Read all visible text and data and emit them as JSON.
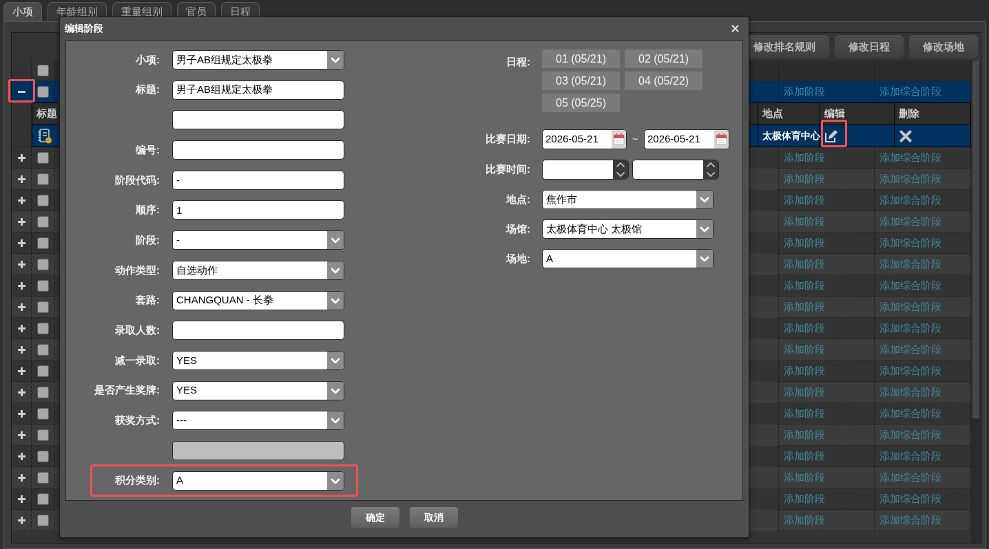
{
  "tabs": [
    {
      "label": "小项",
      "selected": true
    },
    {
      "label": "年龄组别",
      "selected": false
    },
    {
      "label": "重量组别",
      "selected": false
    },
    {
      "label": "官员",
      "selected": false
    },
    {
      "label": "日程",
      "selected": false
    }
  ],
  "toolbar": {
    "buttons": [
      "修改排名规则",
      "修改日程",
      "修改场地"
    ]
  },
  "table": {
    "header": {
      "checked": false
    },
    "rows": [
      {
        "expanded": true,
        "checked": false,
        "selected": true,
        "highlighted": true,
        "column_4": "添加阶段",
        "column_5": "添加综合阶段",
        "stages": {
          "columns": [
            "标题",
            "地点",
            "编辑",
            "删除"
          ],
          "rows": [
            {
              "selected": true,
              "location": "太极体育中心",
              "edit_highlighted": true
            }
          ]
        }
      },
      {
        "expanded": false,
        "checked": false,
        "selected": false,
        "highlighted": false,
        "column_4": "添加阶段",
        "column_5": "添加综合阶段"
      },
      {
        "expanded": false,
        "checked": false,
        "selected": false,
        "highlighted": false,
        "column_4": "添加阶段",
        "column_5": "添加综合阶段"
      },
      {
        "expanded": false,
        "checked": false,
        "selected": false,
        "highlighted": false,
        "column_4": "添加阶段",
        "column_5": "添加综合阶段"
      },
      {
        "expanded": false,
        "checked": false,
        "selected": false,
        "highlighted": false,
        "column_4": "添加阶段",
        "column_5": "添加综合阶段"
      },
      {
        "expanded": false,
        "checked": false,
        "selected": false,
        "highlighted": false,
        "column_4": "添加阶段",
        "column_5": "添加综合阶段"
      },
      {
        "expanded": false,
        "checked": false,
        "selected": false,
        "highlighted": false,
        "column_4": "添加阶段",
        "column_5": "添加综合阶段"
      },
      {
        "expanded": false,
        "checked": false,
        "selected": false,
        "highlighted": false,
        "column_4": "添加阶段",
        "column_5": "添加综合阶段"
      },
      {
        "expanded": false,
        "checked": false,
        "selected": false,
        "highlighted": false,
        "column_4": "添加阶段",
        "column_5": "添加综合阶段"
      },
      {
        "expanded": false,
        "checked": false,
        "selected": false,
        "highlighted": false,
        "column_4": "添加阶段",
        "column_5": "添加综合阶段"
      },
      {
        "expanded": false,
        "checked": false,
        "selected": false,
        "highlighted": false,
        "column_4": "添加阶段",
        "column_5": "添加综合阶段"
      },
      {
        "expanded": false,
        "checked": false,
        "selected": false,
        "highlighted": false,
        "column_4": "添加阶段",
        "column_5": "添加综合阶段"
      },
      {
        "expanded": false,
        "checked": false,
        "selected": false,
        "highlighted": false,
        "column_4": "添加阶段",
        "column_5": "添加综合阶段"
      },
      {
        "expanded": false,
        "checked": false,
        "selected": false,
        "highlighted": false,
        "column_4": "添加阶段",
        "column_5": "添加综合阶段"
      },
      {
        "expanded": false,
        "checked": false,
        "selected": false,
        "highlighted": false,
        "column_4": "添加阶段",
        "column_5": "添加综合阶段"
      },
      {
        "expanded": false,
        "checked": false,
        "selected": false,
        "highlighted": false,
        "column_4": "添加阶段",
        "column_5": "添加综合阶段"
      },
      {
        "expanded": false,
        "checked": false,
        "selected": false,
        "highlighted": false,
        "column_4": "添加阶段",
        "column_5": "添加综合阶段"
      },
      {
        "expanded": false,
        "checked": false,
        "selected": false,
        "highlighted": false,
        "column_4": "添加阶段",
        "column_5": "添加综合阶段"
      },
      {
        "expanded": false,
        "checked": false,
        "selected": false,
        "highlighted": false,
        "column_4": "添加阶段",
        "column_5": "添加综合阶段"
      }
    ]
  },
  "dialog": {
    "title": "编辑阶段",
    "left_fields": [
      {
        "kind": "select",
        "label": "小项:",
        "value": "男子AB组规定太极拳",
        "disabled": false,
        "highlighted": false
      },
      {
        "kind": "text",
        "label": "标题:",
        "value": "男子AB组规定太极拳",
        "disabled": false,
        "highlighted": false
      },
      {
        "kind": "text",
        "disabled": false,
        "highlighted": false
      },
      {
        "kind": "text",
        "label": "编号:",
        "disabled": false,
        "highlighted": false
      },
      {
        "kind": "text",
        "label": "阶段代码:",
        "value": "-",
        "disabled": false,
        "highlighted": false
      },
      {
        "kind": "text",
        "label": "顺序:",
        "value": "1",
        "disabled": false,
        "highlighted": false
      },
      {
        "kind": "select",
        "label": "阶段:",
        "value": "-",
        "disabled": false,
        "highlighted": false
      },
      {
        "kind": "select",
        "label": "动作类型:",
        "value": "自选动作",
        "disabled": false,
        "highlighted": false
      },
      {
        "kind": "select",
        "label": "套路:",
        "value": "CHANGQUAN - 长拳",
        "disabled": false,
        "highlighted": false
      },
      {
        "kind": "text",
        "label": "录取人数:",
        "disabled": false,
        "highlighted": false
      },
      {
        "kind": "select",
        "label": "减一录取:",
        "value": "YES",
        "disabled": false,
        "highlighted": false
      },
      {
        "kind": "select",
        "label": "是否产生奖牌:",
        "value": "YES",
        "disabled": false,
        "highlighted": false
      },
      {
        "kind": "select",
        "label": "获奖方式:",
        "value": "---",
        "disabled": false,
        "highlighted": false
      },
      {
        "kind": "text",
        "disabled": true,
        "highlighted": false
      },
      {
        "kind": "select",
        "label": "积分类别:",
        "value": "A",
        "disabled": false,
        "highlighted": true
      }
    ],
    "right_fields": [
      {
        "kind": "schedule",
        "label": "日程:",
        "options": [
          {
            "label": "01 (05/21)",
            "selected": false
          },
          {
            "label": "02 (05/21)",
            "selected": false
          },
          {
            "label": "03 (05/21)",
            "selected": false
          },
          {
            "label": "04 (05/22)",
            "selected": false
          },
          {
            "label": "05 (05/25)",
            "selected": false
          }
        ]
      },
      {
        "kind": "date_range",
        "label": "比赛日期:",
        "from": "2026-05-21",
        "separator": "~",
        "to": "2026-05-21"
      },
      {
        "kind": "time_range",
        "label": "比赛时间:"
      },
      {
        "kind": "select",
        "label": "地点:",
        "value": "焦作市"
      },
      {
        "kind": "select",
        "label": "场馆:",
        "value": "太极体育中心 太极馆"
      },
      {
        "kind": "select",
        "label": "场地:",
        "value": "A"
      }
    ],
    "buttons": [
      "确定",
      "取消"
    ]
  }
}
